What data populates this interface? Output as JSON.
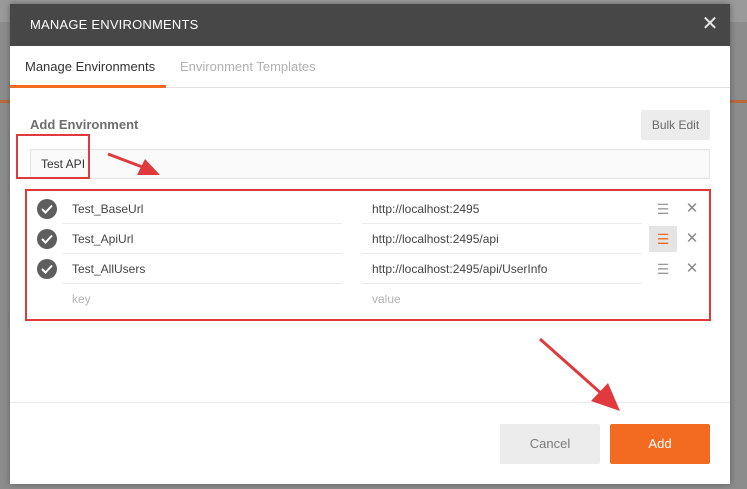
{
  "dialog": {
    "title": "MANAGE ENVIRONMENTS",
    "close_icon": "close-icon"
  },
  "tabs": [
    {
      "label": "Manage Environments",
      "active": true
    },
    {
      "label": "Environment Templates",
      "active": false
    }
  ],
  "form": {
    "section_title": "Add Environment",
    "bulk_edit_label": "Bulk Edit",
    "environment_name": "Test API"
  },
  "variables": [
    {
      "key": "Test_BaseUrl",
      "value": "http://localhost:2495",
      "enabled": true
    },
    {
      "key": "Test_ApiUrl",
      "value": "http://localhost:2495/api",
      "enabled": true
    },
    {
      "key": "Test_AllUsers",
      "value": "http://localhost:2495/api/UserInfo",
      "enabled": true
    }
  ],
  "new_row": {
    "key_placeholder": "key",
    "value_placeholder": "value"
  },
  "footer": {
    "cancel_label": "Cancel",
    "add_label": "Add"
  },
  "colors": {
    "accent": "#f26b21",
    "header_bg": "#474747",
    "annotation_red": "#e0393e"
  },
  "icons": {
    "row_check": "check-circle-icon",
    "row_menu": "hamburger-menu-icon",
    "row_delete": "close-icon"
  }
}
